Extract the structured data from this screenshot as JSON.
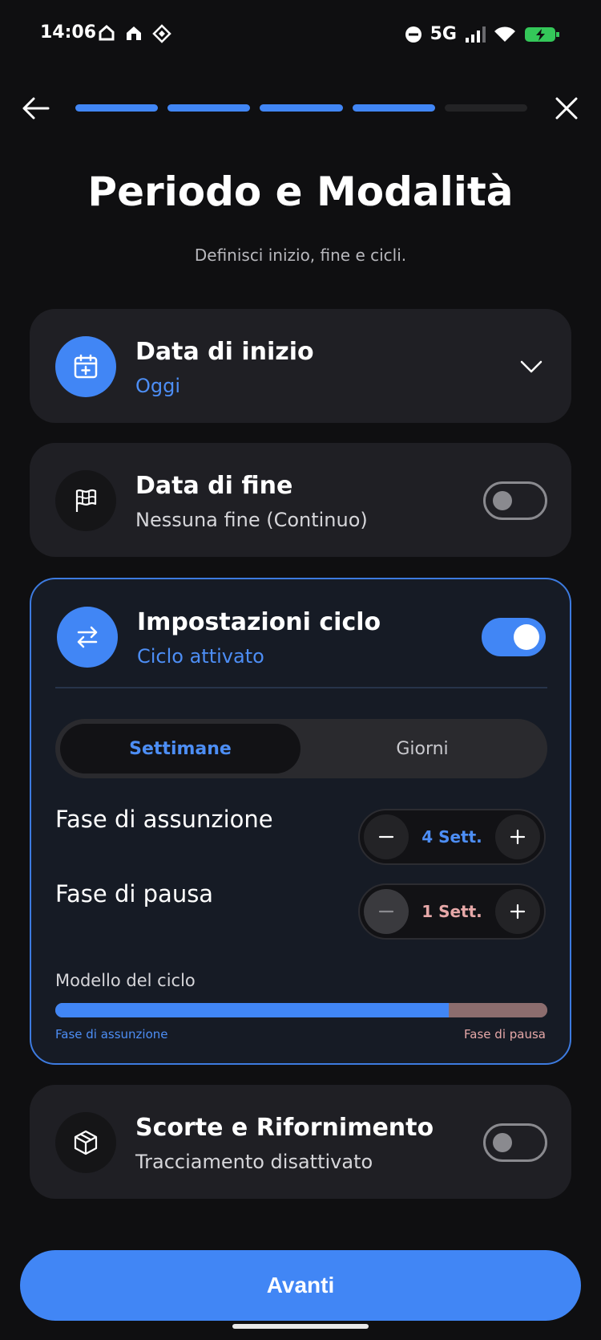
{
  "status_bar": {
    "time": "14:06",
    "network": "5G",
    "battery_color": "#34c759"
  },
  "header": {
    "progress_total": 5,
    "progress_done": 4,
    "accent": "#4186f5"
  },
  "page": {
    "title": "Periodo e Modalità",
    "subtitle": "Definisci inizio, fine e cicli."
  },
  "start_date": {
    "title": "Data di inizio",
    "value": "Oggi",
    "icon": "calendar-plus-icon"
  },
  "end_date": {
    "title": "Data di fine",
    "value": "Nessuna fine (Continuo)",
    "icon": "flag-icon",
    "enabled": false
  },
  "cycle": {
    "title": "Impostazioni ciclo",
    "status": "Ciclo attivato",
    "icon": "swap-arrows-icon",
    "enabled": true,
    "units": {
      "selected": "Settimane",
      "other": "Giorni"
    },
    "intake": {
      "label": "Fase di assunzione",
      "value": "4 Sett."
    },
    "pause": {
      "label": "Fase di pausa",
      "value": "1 Sett."
    },
    "model": {
      "label": "Modello del ciclo",
      "intake_label": "Fase di assunzione",
      "pause_label": "Fase di pausa",
      "intake_fraction": 0.8
    }
  },
  "stock": {
    "title": "Scorte e Rifornimento",
    "value": "Tracciamento disattivato",
    "icon": "box-icon",
    "enabled": false
  },
  "footer": {
    "next_label": "Avanti"
  }
}
